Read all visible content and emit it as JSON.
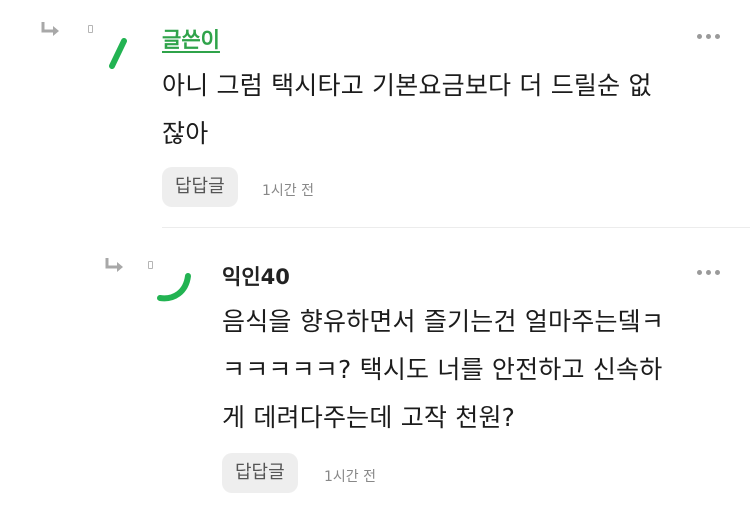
{
  "comments": [
    {
      "author": "글쓴이",
      "lines": [
        "아니 그럼 택시타고 기본요금보다 더 드릴순 없",
        "잖아"
      ],
      "reply_label": "답답글",
      "time": "1시간 전"
    },
    {
      "author": "익인40",
      "lines": [
        "음식을 향유하면서 즐기는건 얼마주는뎈ㅋ",
        "ㅋㅋㅋㅋㅋ? 택시도 너를 안전하고 신속하",
        "게 데려다주는데 고작 천원?"
      ],
      "reply_label": "답답글",
      "time": "1시간 전"
    }
  ],
  "colors": {
    "author_highlight": "#2fa34a",
    "avatar_accent": "#22b352"
  },
  "icons": {
    "reply_indent": "reply-arrow-icon",
    "more": "more-options-icon"
  }
}
